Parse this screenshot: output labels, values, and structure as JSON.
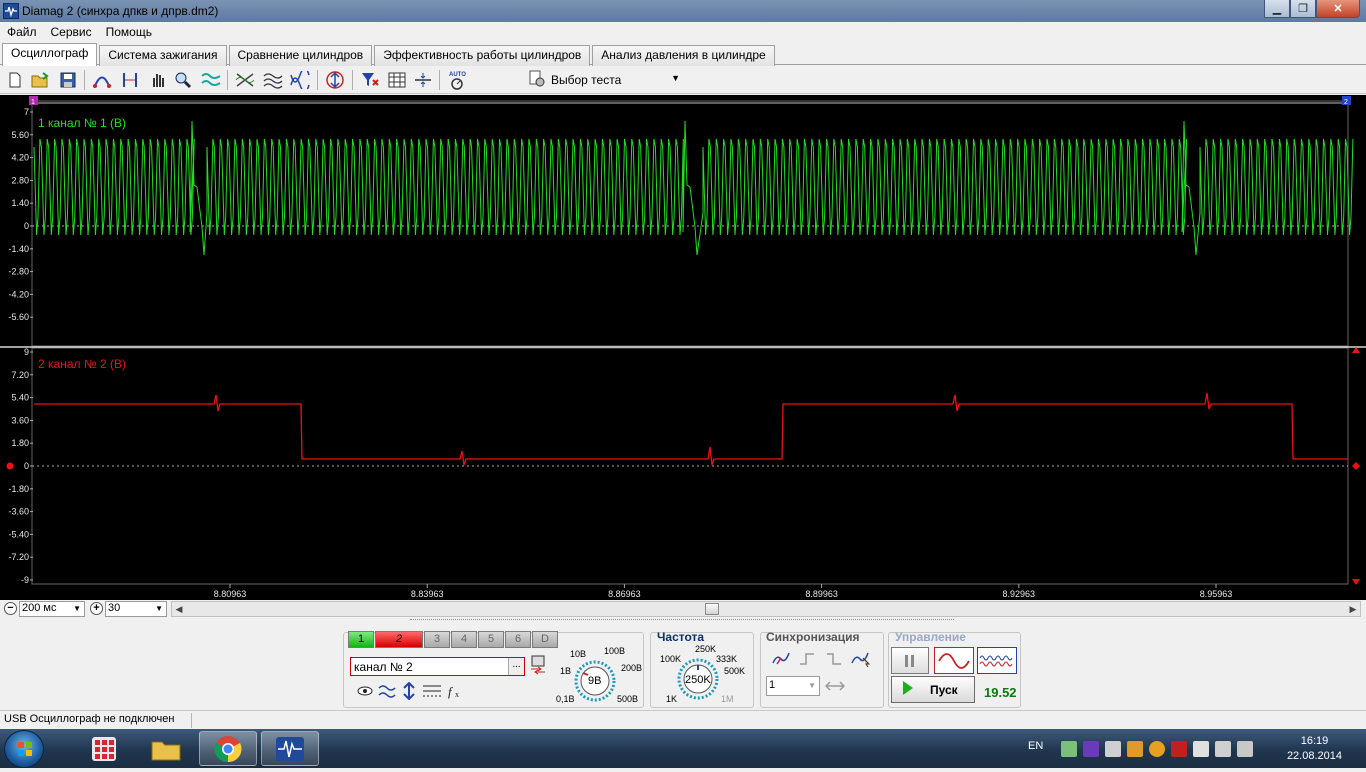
{
  "window": {
    "title": "Diamag 2 (синхра дпкв и дпрв.dm2)",
    "minimize": "▁",
    "maximize": "❐",
    "close": "✕"
  },
  "menu": [
    "Файл",
    "Сервис",
    "Помощь"
  ],
  "tabs": [
    {
      "label": "Осциллограф",
      "active": true
    },
    {
      "label": "Система зажигания",
      "active": false
    },
    {
      "label": "Сравнение цилиндров",
      "active": false
    },
    {
      "label": "Эффективность работы цилиндров",
      "active": false
    },
    {
      "label": "Анализ давления в цилиндре",
      "active": false
    }
  ],
  "toolbar": {
    "icons": [
      "new-file-icon",
      "open-folder-icon",
      "save-icon",
      "cursor-arc-icon",
      "cursor-measure-icon",
      "hand-icon",
      "zoom-icon",
      "signal-filter-icon",
      "cross-wave-icon",
      "multi-wave-icon",
      "overlay-wave-icon",
      "auto-scale-icon",
      "filter-channel-icon",
      "grid-icon",
      "horizontal-split-icon",
      "auto-icon"
    ],
    "test_select": "Выбор теста",
    "test_select_icon": "gear-test-icon"
  },
  "scope": {
    "channel1": {
      "label": "1 канал № 1 (В)",
      "color": "#22dd22",
      "ticks": [
        "7",
        "5.60",
        "4.20",
        "2.80",
        "1.40",
        "0",
        "-1.40",
        "-2.80",
        "-4.20",
        "-5.60"
      ],
      "marker": "1"
    },
    "channel2": {
      "label": "2 канал № 2 (В)",
      "color": "#ee1111",
      "ticks": [
        "9",
        "7.20",
        "5.40",
        "3.60",
        "1.80",
        "0",
        "-1.80",
        "-3.60",
        "-5.40",
        "-7.20",
        "-9"
      ],
      "marker": "2"
    },
    "time_ticks": [
      "8.80963",
      "8.83963",
      "8.86963",
      "8.89963",
      "8.92963",
      "8.95963"
    ]
  },
  "scalebar": {
    "timebase": "200 мс",
    "points": "30"
  },
  "panel": {
    "channel_buttons": [
      "1",
      "2",
      "3",
      "4",
      "5",
      "6",
      "D"
    ],
    "channel_name": "канал № 2",
    "channel_name_ellipsis": "...",
    "volt_knob": {
      "value": "9В",
      "labels": [
        "10В",
        "100В",
        "1В",
        "200В",
        "0,1В",
        "500В"
      ]
    },
    "freq_group": {
      "title": "Частота",
      "value": "250K",
      "labels": [
        "250K",
        "100K",
        "333K",
        "500K",
        "1K",
        "1M"
      ]
    },
    "sync_group": {
      "title": "Синхронизация",
      "select": "1"
    },
    "control_group": {
      "title": "Управление",
      "start": "Пуск",
      "value": "19.52"
    }
  },
  "status": {
    "text": "USB Осциллограф не подключен"
  },
  "taskbar": {
    "lang": "EN",
    "time": "16:19",
    "date": "22.08.2014"
  },
  "colors": {
    "ch1": "#22dd22",
    "ch2": "#ee1111",
    "scope_bg": "#000000",
    "accent": "#d40000"
  }
}
